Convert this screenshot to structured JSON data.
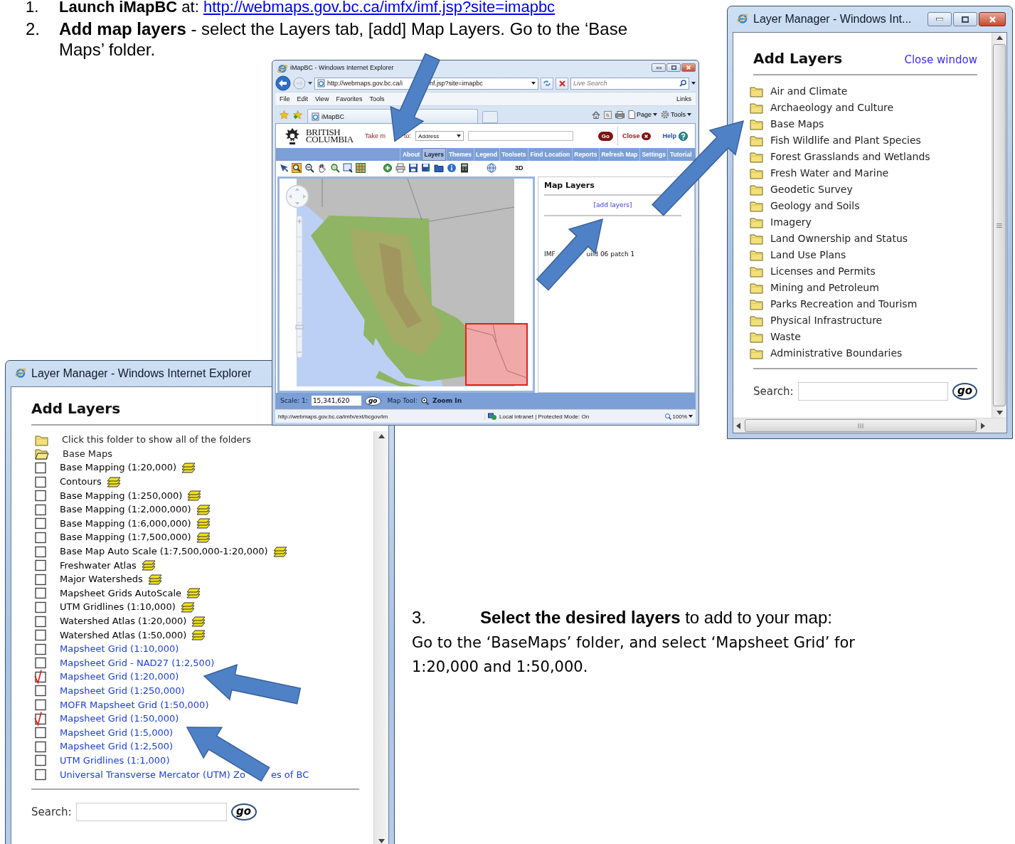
{
  "steps": [
    {
      "number": "1.",
      "text": "**Launch iMapBC** at:",
      "link": "http://webmaps.gov.bc.ca/imfx/imf.jsp?site=imapbc"
    },
    {
      "number": "2.",
      "text": "**Add map layers** - select the Layers tab, [add] Map Layers.  Go to the ‘Base Maps’ folder."
    },
    {
      "number": "3.",
      "text": "**Select the desired layers** to add to your map:",
      "detail": "Go to the ‘BaseMaps’ folder, and select ‘Mapsheet Grid’ for 1:20,000 and 1:50,000."
    }
  ],
  "browser": {
    "title": "iMapBC - Windows Internet Explorer",
    "address_parts": [
      "http://webmaps.gov.bc.ca/i",
      "nf.jsp?site=imapbc"
    ],
    "search_placeholder": "Live Search",
    "menu": [
      "File",
      "Edit",
      "View",
      "Favorites",
      "Tools"
    ],
    "links": "Links",
    "tab": "iMapBC",
    "commands": [
      "Page",
      "Tools"
    ],
    "site": {
      "logo": [
        "BRITISH",
        "COLUMBIA"
      ],
      "take_me_to_parts": [
        "Take m",
        "to:"
      ],
      "location_type": "Address",
      "go": "Go",
      "close": "Close",
      "help": "Help",
      "nav": [
        {
          "label": "About",
          "selected": false
        },
        {
          "label": "Layers",
          "selected": true
        },
        {
          "label": "Themes",
          "selected": false
        },
        {
          "label": "Legend",
          "selected": false
        },
        {
          "label": "Toolsets",
          "selected": false
        },
        {
          "label": "Find Location",
          "selected": false
        },
        {
          "label": "Reports",
          "selected": false
        },
        {
          "label": "Refresh Map",
          "selected": false
        },
        {
          "label": "Settings",
          "selected": false
        },
        {
          "label": "Tutorial",
          "selected": false
        }
      ],
      "view_toggle": "3D",
      "panel": {
        "title": "Map Layers",
        "add_link": "[add layers]",
        "version_parts": [
          "IMF",
          "uild 06 patch 1"
        ]
      },
      "scale_label": "Scale: 1:",
      "scale": "15,341,620",
      "scale_go": "go",
      "tool_label": "Map Tool:",
      "tool": "Zoom In"
    },
    "status": {
      "url": "http://webmaps.gov.bc.ca/imfx/ext/bcgov/im",
      "zone": "Local intranet | Protected Mode: On",
      "zoom": "100%"
    }
  },
  "left_layer_manager": {
    "title": "Layer Manager - Windows Internet Explorer",
    "heading": "Add Layers",
    "items": [
      {
        "kind": "folder",
        "label": "Click this folder to show all of the folders"
      },
      {
        "kind": "open-folder",
        "label": "Base Maps"
      },
      {
        "kind": "layer",
        "label": "Base Mapping (1:20,000)",
        "checked": false,
        "color": "#000000",
        "legend_icon": true
      },
      {
        "kind": "layer",
        "label": "Contours",
        "checked": false,
        "color": "#000000",
        "legend_icon": true
      },
      {
        "kind": "layer",
        "label": "Base Mapping (1:250,000)",
        "checked": false,
        "color": "#000000",
        "legend_icon": true
      },
      {
        "kind": "layer",
        "label": "Base Mapping (1:2,000,000)",
        "checked": false,
        "color": "#000000",
        "legend_icon": true
      },
      {
        "kind": "layer",
        "label": "Base Mapping (1:6,000,000)",
        "checked": false,
        "color": "#000000",
        "legend_icon": true
      },
      {
        "kind": "layer",
        "label": "Base Mapping (1:7,500,000)",
        "checked": false,
        "color": "#000000",
        "legend_icon": true
      },
      {
        "kind": "layer",
        "label": "Base Map Auto Scale (1:7,500,000-1:20,000)",
        "checked": false,
        "color": "#000000",
        "legend_icon": true
      },
      {
        "kind": "layer",
        "label": "Freshwater Atlas",
        "checked": false,
        "color": "#000000",
        "legend_icon": true
      },
      {
        "kind": "layer",
        "label": "Major Watersheds",
        "checked": false,
        "color": "#000000",
        "legend_icon": true
      },
      {
        "kind": "layer",
        "label": "Mapsheet Grids AutoScale",
        "checked": false,
        "color": "#000000",
        "legend_icon": true
      },
      {
        "kind": "layer",
        "label": "UTM Gridlines (1:10,000)",
        "checked": false,
        "color": "#000000",
        "legend_icon": true
      },
      {
        "kind": "layer",
        "label": "Watershed Atlas (1:20,000)",
        "checked": false,
        "color": "#000000",
        "legend_icon": true
      },
      {
        "kind": "layer",
        "label": "Watershed Atlas (1:50,000)",
        "checked": false,
        "color": "#000000",
        "legend_icon": true
      },
      {
        "kind": "layer",
        "label": "Mapsheet Grid (1:10,000)",
        "checked": false,
        "color": "#1c3fd1",
        "legend_icon": false
      },
      {
        "kind": "layer",
        "label": "Mapsheet Grid - NAD27 (1:2,500)",
        "checked": false,
        "color": "#1c3fd1",
        "legend_icon": false
      },
      {
        "kind": "layer",
        "label": "Mapsheet Grid (1:20,000)",
        "checked": true,
        "color": "#1c3fd1",
        "legend_icon": false
      },
      {
        "kind": "layer",
        "label": "Mapsheet Grid (1:250,000)",
        "checked": false,
        "color": "#1c3fd1",
        "legend_icon": false
      },
      {
        "kind": "layer",
        "label": "MOFR Mapsheet Grid (1:50,000)",
        "checked": false,
        "color": "#1c3fd1",
        "legend_icon": false
      },
      {
        "kind": "layer",
        "label": "Mapsheet Grid (1:50,000)",
        "checked": true,
        "color": "#1c3fd1",
        "legend_icon": false
      },
      {
        "kind": "layer",
        "label": "Mapsheet Grid (1:5,000)",
        "checked": false,
        "color": "#1c3fd1",
        "legend_icon": false
      },
      {
        "kind": "layer",
        "label": "Mapsheet Grid (1:2,500)",
        "checked": false,
        "color": "#1c3fd1",
        "legend_icon": false
      },
      {
        "kind": "layer",
        "label": "UTM Gridlines (1:1,000)",
        "checked": false,
        "color": "#1c3fd1",
        "legend_icon": false
      },
      {
        "kind": "layer",
        "label_parts": [
          "Universal Transverse Mercator (UTM) Zo",
          "es of BC"
        ],
        "checked": false,
        "color": "#1c3fd1",
        "legend_icon": false
      }
    ],
    "search_label": "Search:",
    "go": "go"
  },
  "right_layer_manager": {
    "title": "Layer Manager - Windows Int...",
    "heading": "Add Layers",
    "close_link": "Close window",
    "items": [
      {
        "kind": "folder",
        "label": "Air and Climate"
      },
      {
        "kind": "folder",
        "label": "Archaeology and Culture"
      },
      {
        "kind": "folder",
        "label": "Base Maps"
      },
      {
        "kind": "folder",
        "label": "Fish Wildlife and Plant Species"
      },
      {
        "kind": "folder",
        "label": "Forest Grasslands and Wetlands"
      },
      {
        "kind": "folder",
        "label": "Fresh Water and Marine"
      },
      {
        "kind": "folder",
        "label": "Geodetic Survey"
      },
      {
        "kind": "folder",
        "label": "Geology and Soils"
      },
      {
        "kind": "folder",
        "label": "Imagery"
      },
      {
        "kind": "folder",
        "label": "Land Ownership and Status"
      },
      {
        "kind": "folder",
        "label": "Land Use Plans"
      },
      {
        "kind": "folder",
        "label": "Licenses and Permits"
      },
      {
        "kind": "folder",
        "label": "Mining and Petroleum"
      },
      {
        "kind": "folder",
        "label": "Parks Recreation and Tourism"
      },
      {
        "kind": "folder",
        "label": "Physical Infrastructure"
      },
      {
        "kind": "folder",
        "label": "Waste"
      },
      {
        "kind": "folder",
        "label": "Administrative Boundaries"
      }
    ],
    "search_label": "Search:",
    "go": "go"
  }
}
